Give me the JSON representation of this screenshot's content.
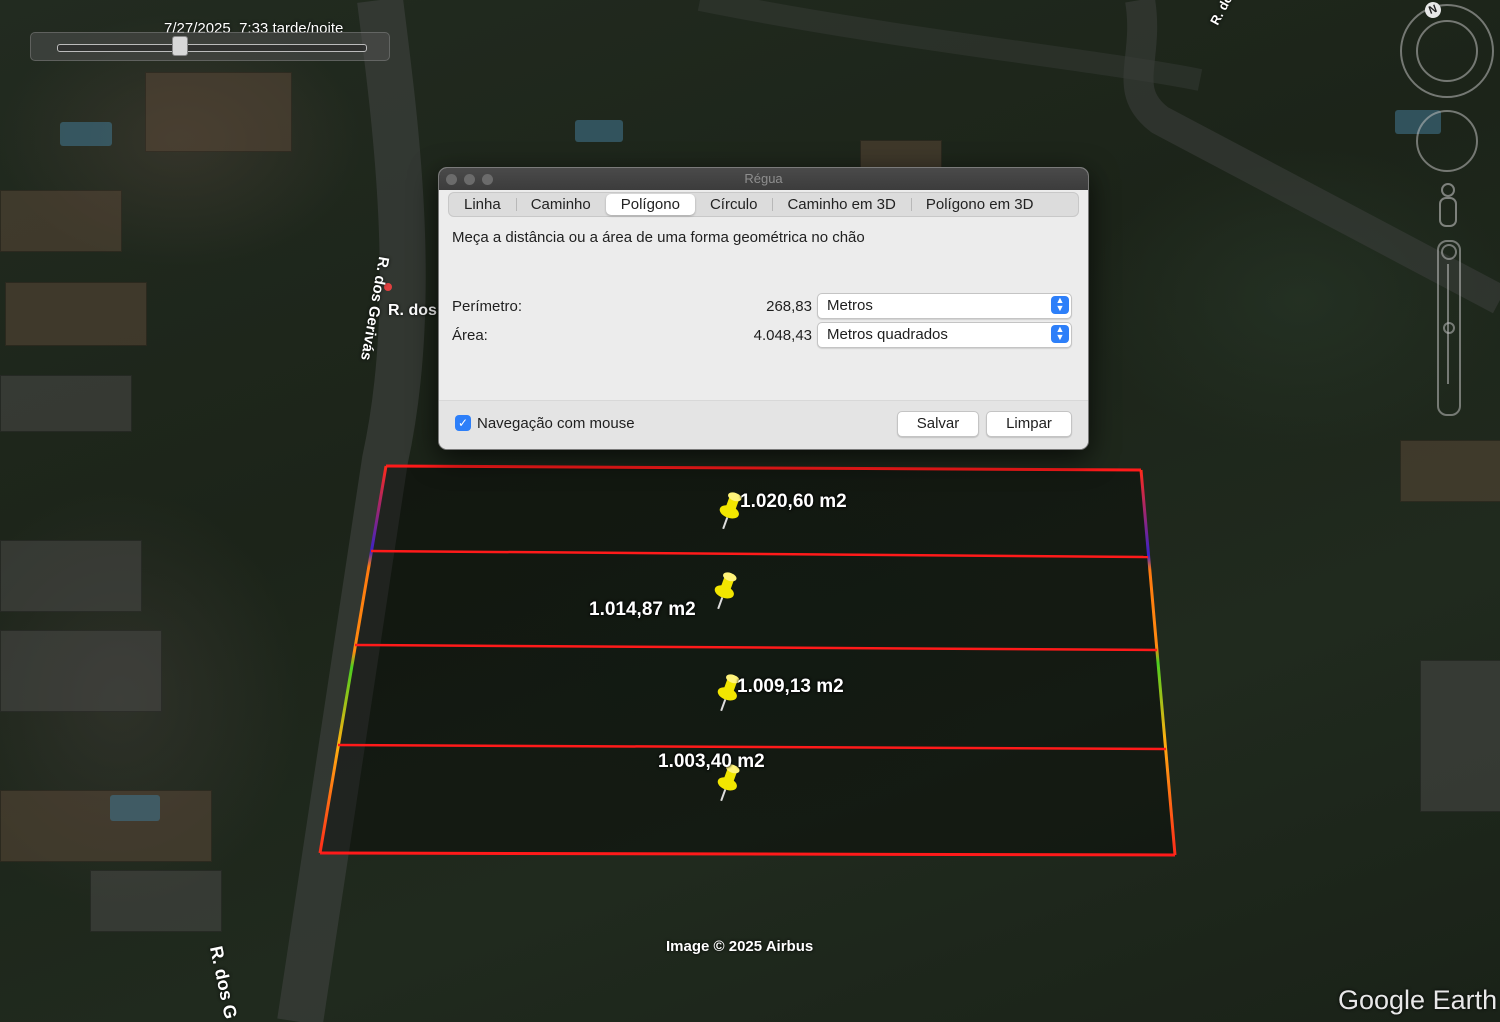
{
  "time_slider": {
    "date": "7/27/2025",
    "time": "7:33 tarde/noite"
  },
  "roads": {
    "label_left_vertical": "R. dos Gerivás",
    "label_left_short": "R. dos",
    "label_bottom": "R. dos G",
    "label_top_right": "R. do"
  },
  "dialog": {
    "title": "Régua",
    "tabs": [
      "Linha",
      "Caminho",
      "Polígono",
      "Círculo",
      "Caminho em 3D",
      "Polígono em 3D"
    ],
    "active_tab": "Polígono",
    "description": "Meça a distância ou a área de uma forma geométrica no chão",
    "perimeter": {
      "label": "Perímetro:",
      "value": "268,83",
      "unit": "Metros"
    },
    "area": {
      "label": "Área:",
      "value": "4.048,43",
      "unit": "Metros quadrados"
    },
    "mouse_nav": {
      "label": "Navegação com mouse",
      "checked": true
    },
    "save_label": "Salvar",
    "clear_label": "Limpar"
  },
  "placemarks": [
    "1.020,60 m2",
    "1.014,87 m2",
    "1.009,13 m2",
    "1.003,40 m2"
  ],
  "attribution": "Image © 2025 Airbus",
  "logo": "Google Earth",
  "compass": {
    "north": "N"
  },
  "colors": {
    "polygon_line": "#ff1a1a",
    "pin": "#f2e600",
    "accent": "#2d7ff9"
  }
}
